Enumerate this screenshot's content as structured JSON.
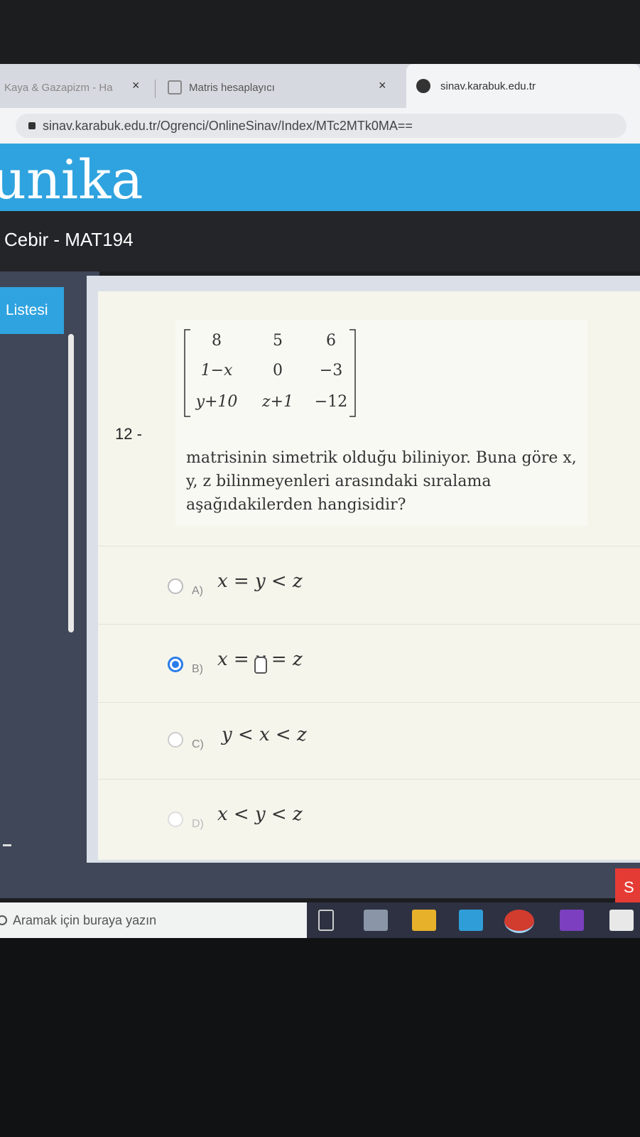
{
  "browser": {
    "tabs": [
      {
        "label": "Kaya & Gazapizm - Ha"
      },
      {
        "label": "Matris hesaplayıcı"
      },
      {
        "label": "sinav.karabuk.edu.tr"
      }
    ],
    "close_glyph": "×",
    "url": "sinav.karabuk.edu.tr/Ogrenci/OnlineSinav/Index/MTc2MTk0MA=="
  },
  "site": {
    "logo_text": "unika",
    "course_title": "Cebir - MAT194",
    "sidebar_button": "Listesi"
  },
  "question": {
    "number": "12 -",
    "matrix": [
      [
        "8",
        "5",
        "6"
      ],
      [
        "1−x",
        "0",
        "−3"
      ],
      [
        "y+10",
        "z+1",
        "−12"
      ]
    ],
    "text": "matrisinin simetrik olduğu biliniyor. Buna göre x, y, z bilinmeyenleri arasındaki sıralama aşağıdakilerden hangisidir?",
    "options": [
      {
        "letter": "A)",
        "math": "x = y < z",
        "selected": false
      },
      {
        "letter": "B)",
        "math": "x = y = z",
        "selected": true
      },
      {
        "letter": "C)",
        "math": "y < x < z",
        "selected": false
      },
      {
        "letter": "D)",
        "math": "x < y < z",
        "selected": false
      }
    ]
  },
  "footer": {
    "red_button": "S"
  },
  "taskbar": {
    "search_placeholder": "Aramak için buraya yazın"
  },
  "colors": {
    "accent_blue": "#2fa3df",
    "radio_selected": "#2b7de9",
    "danger": "#e53b35"
  }
}
